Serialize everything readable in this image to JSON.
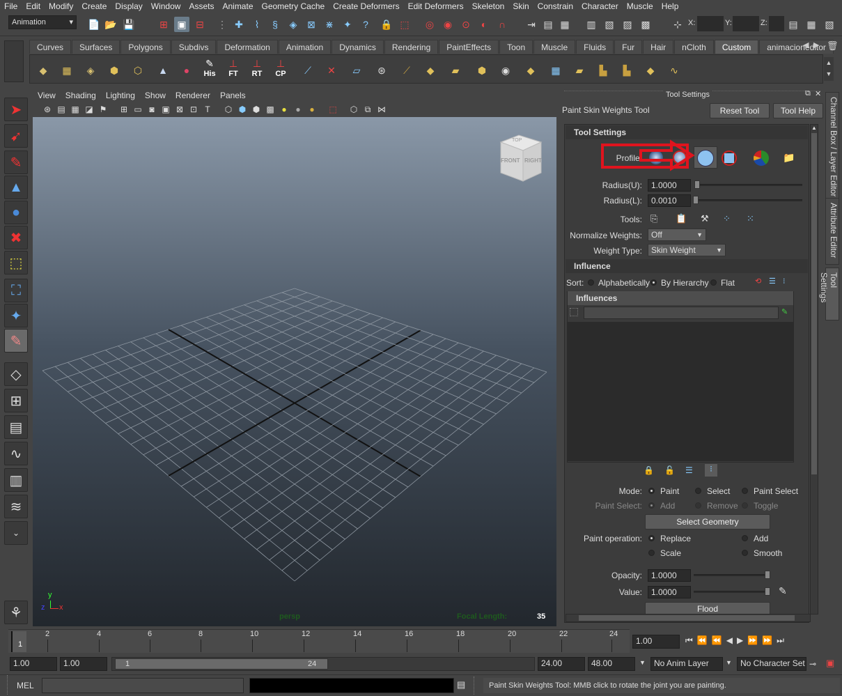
{
  "menu": [
    "File",
    "Edit",
    "Modify",
    "Create",
    "Display",
    "Window",
    "Assets",
    "Animate",
    "Geometry Cache",
    "Create Deformers",
    "Edit Deformers",
    "Skeleton",
    "Skin",
    "Constrain",
    "Character",
    "Muscle",
    "Help"
  ],
  "status": {
    "mode": "Animation",
    "x_label": "X:",
    "y_label": "Y:",
    "z_label": "Z:"
  },
  "shelf_tabs": [
    "Curves",
    "Surfaces",
    "Polygons",
    "Subdivs",
    "Deformation",
    "Animation",
    "Dynamics",
    "Rendering",
    "PaintEffects",
    "Toon",
    "Muscle",
    "Fluids",
    "Fur",
    "Hair",
    "nCloth",
    "Custom",
    "animacioneditor"
  ],
  "shelf_active": "Custom",
  "shelf_labels": {
    "his": "His",
    "ft": "FT",
    "rt": "RT",
    "cp": "CP"
  },
  "viewport": {
    "menu": [
      "View",
      "Shading",
      "Lighting",
      "Show",
      "Renderer",
      "Panels"
    ],
    "camera_label": "persp",
    "focal_label": "Focal Length:",
    "focal_value": "35",
    "cube_top": "TOP",
    "cube_front": "FRONT",
    "cube_right": "RIGHT",
    "axis_y": "y",
    "axis_x": "x",
    "axis_z": "z"
  },
  "panel": {
    "header": "Tool Settings",
    "tool_name": "Paint Skin Weights Tool",
    "reset_btn": "Reset Tool",
    "help_btn": "Tool Help",
    "section_tool": "Tool Settings",
    "profile_label": "Profile:",
    "radius_u_label": "Radius(U):",
    "radius_u": "1.0000",
    "radius_l_label": "Radius(L):",
    "radius_l": "0.0010",
    "tools_label": "Tools:",
    "normalize_label": "Normalize Weights:",
    "normalize_value": "Off",
    "weight_type_label": "Weight Type:",
    "weight_type_value": "Skin Weight",
    "section_influence": "Influence",
    "sort_label": "Sort:",
    "sort_alpha": "Alphabetically",
    "sort_hier": "By Hierarchy",
    "sort_flat": "Flat",
    "influences_header": "Influences",
    "mode_label": "Mode:",
    "mode_paint": "Paint",
    "mode_select": "Select",
    "mode_paint_select": "Paint Select",
    "paint_select_label": "Paint Select:",
    "ps_add": "Add",
    "ps_remove": "Remove",
    "ps_toggle": "Toggle",
    "select_geometry_btn": "Select Geometry",
    "paint_op_label": "Paint operation:",
    "op_replace": "Replace",
    "op_add": "Add",
    "op_scale": "Scale",
    "op_smooth": "Smooth",
    "opacity_label": "Opacity:",
    "opacity": "1.0000",
    "value_label": "Value:",
    "value": "1.0000",
    "flood_btn": "Flood"
  },
  "side_tabs": [
    "Channel Box / Layer Editor",
    "Attribute Editor",
    "Tool Settings"
  ],
  "timeline": {
    "ticks": [
      "2",
      "4",
      "6",
      "8",
      "10",
      "12",
      "14",
      "16",
      "18",
      "20",
      "22",
      "24"
    ],
    "current": "1",
    "current_time": "1.00"
  },
  "range": {
    "start": "1.00",
    "playback_start": "1.00",
    "slider_min": "1",
    "slider_max": "24",
    "playback_end": "24.00",
    "end": "48.00",
    "anim_layer": "No Anim Layer",
    "char_set": "No Character Set"
  },
  "cmd": {
    "lang": "MEL",
    "help_line": "Paint Skin Weights Tool: MMB click to rotate the joint you are painting."
  },
  "colors": {
    "highlight_red": "#e0141e",
    "accent_blue": "#5a8fd8",
    "bg": "#444444"
  }
}
